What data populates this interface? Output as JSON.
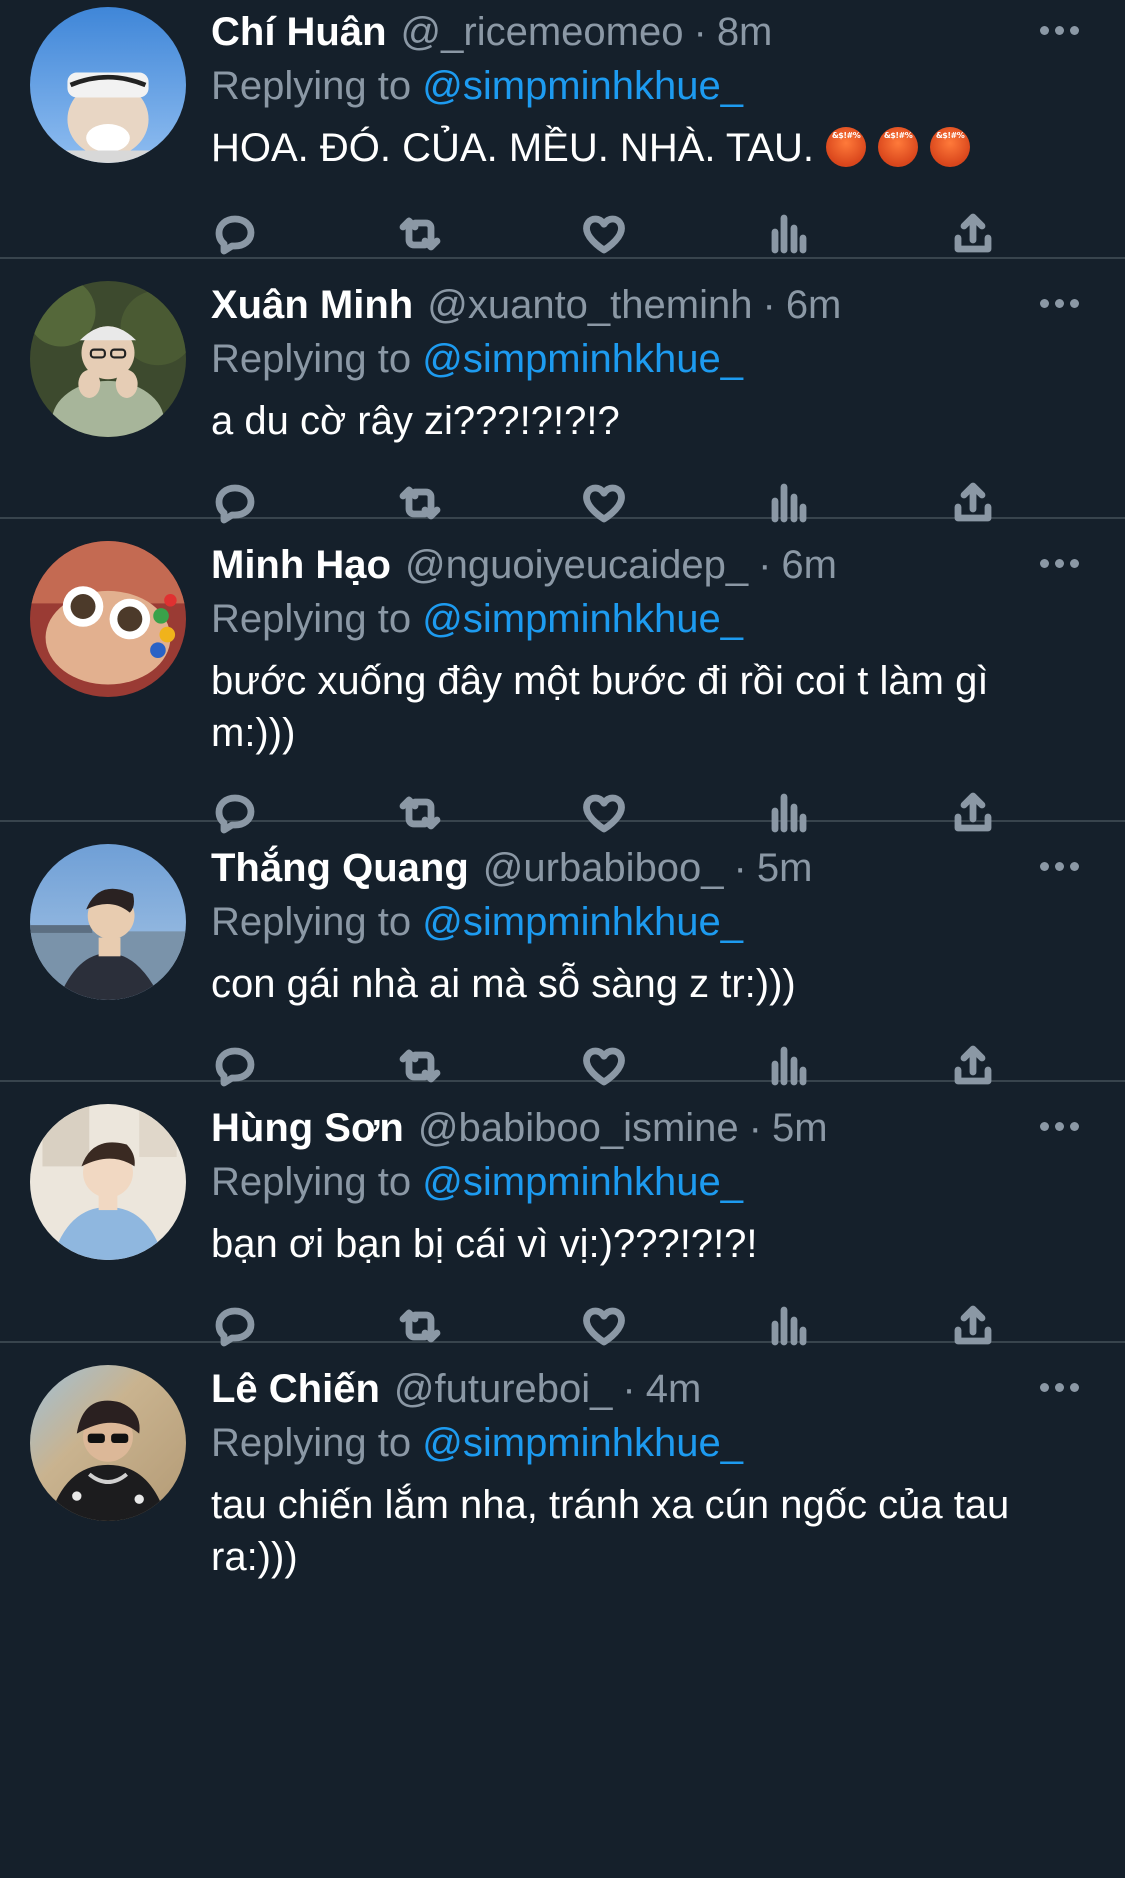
{
  "reply_prefix": "Replying to",
  "colors": {
    "background": "#15202b",
    "accent": "#1d9bf0",
    "muted": "#8b98a5",
    "divider": "#38444d"
  },
  "action_icons": [
    "reply-icon",
    "retweet-icon",
    "like-icon",
    "analytics-icon",
    "share-icon"
  ],
  "tweets": [
    {
      "name": "Chí Huân",
      "handle": "@_ricemeomeo",
      "time": "8m",
      "reply_to": "@simpminhkhue_",
      "text": "HOA. ĐÓ. CỦA. MỀU. NHÀ. TAU.",
      "emoji_count": 3,
      "emoji_name": "symbols-over-mouth-emoji"
    },
    {
      "name": "Xuân Minh",
      "handle": "@xuanto_theminh",
      "time": "6m",
      "reply_to": "@simpminhkhue_",
      "text": "a du cờ rây zi???!?!?!?"
    },
    {
      "name": "Minh Hạo",
      "handle": "@nguoiyeucaidep_",
      "time": "6m",
      "reply_to": "@simpminhkhue_",
      "text": "bước xuống đây một bước đi rồi coi t làm gì m:)))"
    },
    {
      "name": "Thắng Quang",
      "handle": "@urbabiboo_",
      "time": "5m",
      "reply_to": "@simpminhkhue_",
      "text": "con gái nhà ai mà sỗ sàng z tr:)))"
    },
    {
      "name": "Hùng Sơn",
      "handle": "@babiboo_ismine",
      "time": "5m",
      "reply_to": "@simpminhkhue_",
      "text": "bạn ơi bạn bị cái vì vị:)???!?!?!"
    },
    {
      "name": "Lê Chiến",
      "handle": "@futureboi_",
      "time": "4m",
      "reply_to": "@simpminhkhue_",
      "text": "tau chiến lắm nha, tránh xa cún ngốc của tau ra:)))"
    }
  ]
}
